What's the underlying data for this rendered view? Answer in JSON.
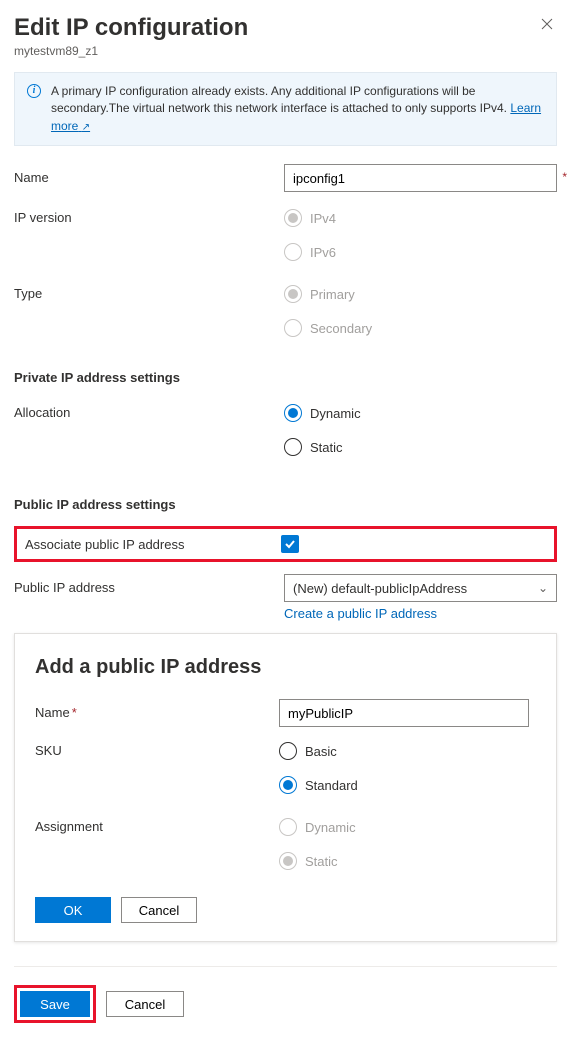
{
  "header": {
    "title": "Edit IP configuration",
    "subtitle": "mytestvm89_z1"
  },
  "info": {
    "text": "A primary IP configuration already exists. Any additional IP configurations will be secondary.The virtual network this network interface is attached to only supports IPv4.   ",
    "link": "Learn more"
  },
  "fields": {
    "name_label": "Name",
    "name_value": "ipconfig1",
    "ipversion_label": "IP version",
    "ipv4": "IPv4",
    "ipv6": "IPv6",
    "type_label": "Type",
    "type_primary": "Primary",
    "type_secondary": "Secondary"
  },
  "private": {
    "section": "Private IP address settings",
    "allocation_label": "Allocation",
    "dynamic": "Dynamic",
    "static": "Static"
  },
  "public": {
    "section": "Public IP address settings",
    "associate_label": "Associate public IP address",
    "address_label": "Public IP address",
    "select_value": "(New) default-publicIpAddress",
    "create_link": "Create a public IP address"
  },
  "add_panel": {
    "title": "Add a public IP address",
    "name_label": "Name",
    "name_value": "myPublicIP",
    "sku_label": "SKU",
    "sku_basic": "Basic",
    "sku_standard": "Standard",
    "assign_label": "Assignment",
    "assign_dynamic": "Dynamic",
    "assign_static": "Static",
    "ok": "OK",
    "cancel": "Cancel"
  },
  "footer": {
    "save": "Save",
    "cancel": "Cancel"
  }
}
